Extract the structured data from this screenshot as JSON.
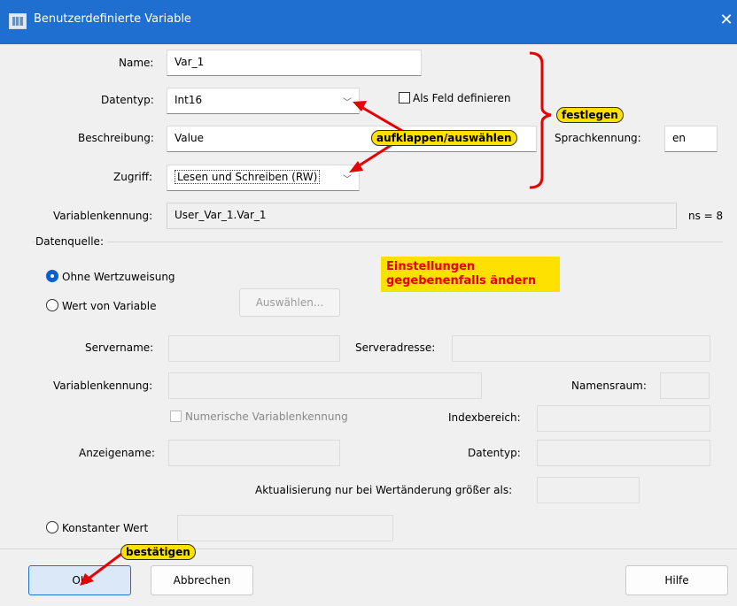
{
  "window": {
    "title": "Benutzerdefinierte Variable",
    "close_glyph": "✕"
  },
  "form": {
    "name_label": "Name:",
    "name_value": "Var_1",
    "datentyp_label": "Datentyp:",
    "datentyp_value": "Int16",
    "als_feld_label": "Als Feld definieren",
    "beschreibung_label": "Beschreibung:",
    "beschreibung_value": "Value",
    "sprachkennung_label": "Sprachkennung:",
    "sprachkennung_value": "en",
    "zugriff_label": "Zugriff:",
    "zugriff_value": "Lesen und Schreiben (RW)",
    "variablenkennung_label": "Variablenkennung:",
    "variablenkennung_value": "User_Var_1.Var_1",
    "ns_label": "ns = 8"
  },
  "datenquelle": {
    "group_label": "Datenquelle:",
    "ohne_label": "Ohne Wertzuweisung",
    "wert_von_label": "Wert von Variable",
    "auswaehlen_label": "Auswählen...",
    "servername_label": "Servername:",
    "serveradresse_label": "Serveradresse:",
    "variablenkennung_label": "Variablenkennung:",
    "namensraum_label": "Namensraum:",
    "numerische_label": "Numerische Variablenkennung",
    "indexbereich_label": "Indexbereich:",
    "anzeigename_label": "Anzeigename:",
    "datentyp_label": "Datentyp:",
    "aktualisierung_label": "Aktualisierung nur bei Wertänderung größer als:",
    "konstanter_label": "Konstanter Wert"
  },
  "buttons": {
    "ok": "OK",
    "abbrechen": "Abbrechen",
    "hilfe": "Hilfe"
  },
  "annotations": {
    "festlegen": "festlegen",
    "aufklappen": "aufklappen/auswählen",
    "einstellungen_line1": "Einstellungen",
    "einstellungen_line2": "gegebenenfalls ändern",
    "bestaetigen": "bestätigen"
  },
  "colors": {
    "accent": "#1f6fd1",
    "annotation_red": "#e60000",
    "annotation_yellow": "#ffe100"
  },
  "icons": {
    "app": "app-icon",
    "close": "close-icon",
    "dropdown": "chevron-down-icon",
    "radio_selected": "radio-checked-icon"
  }
}
